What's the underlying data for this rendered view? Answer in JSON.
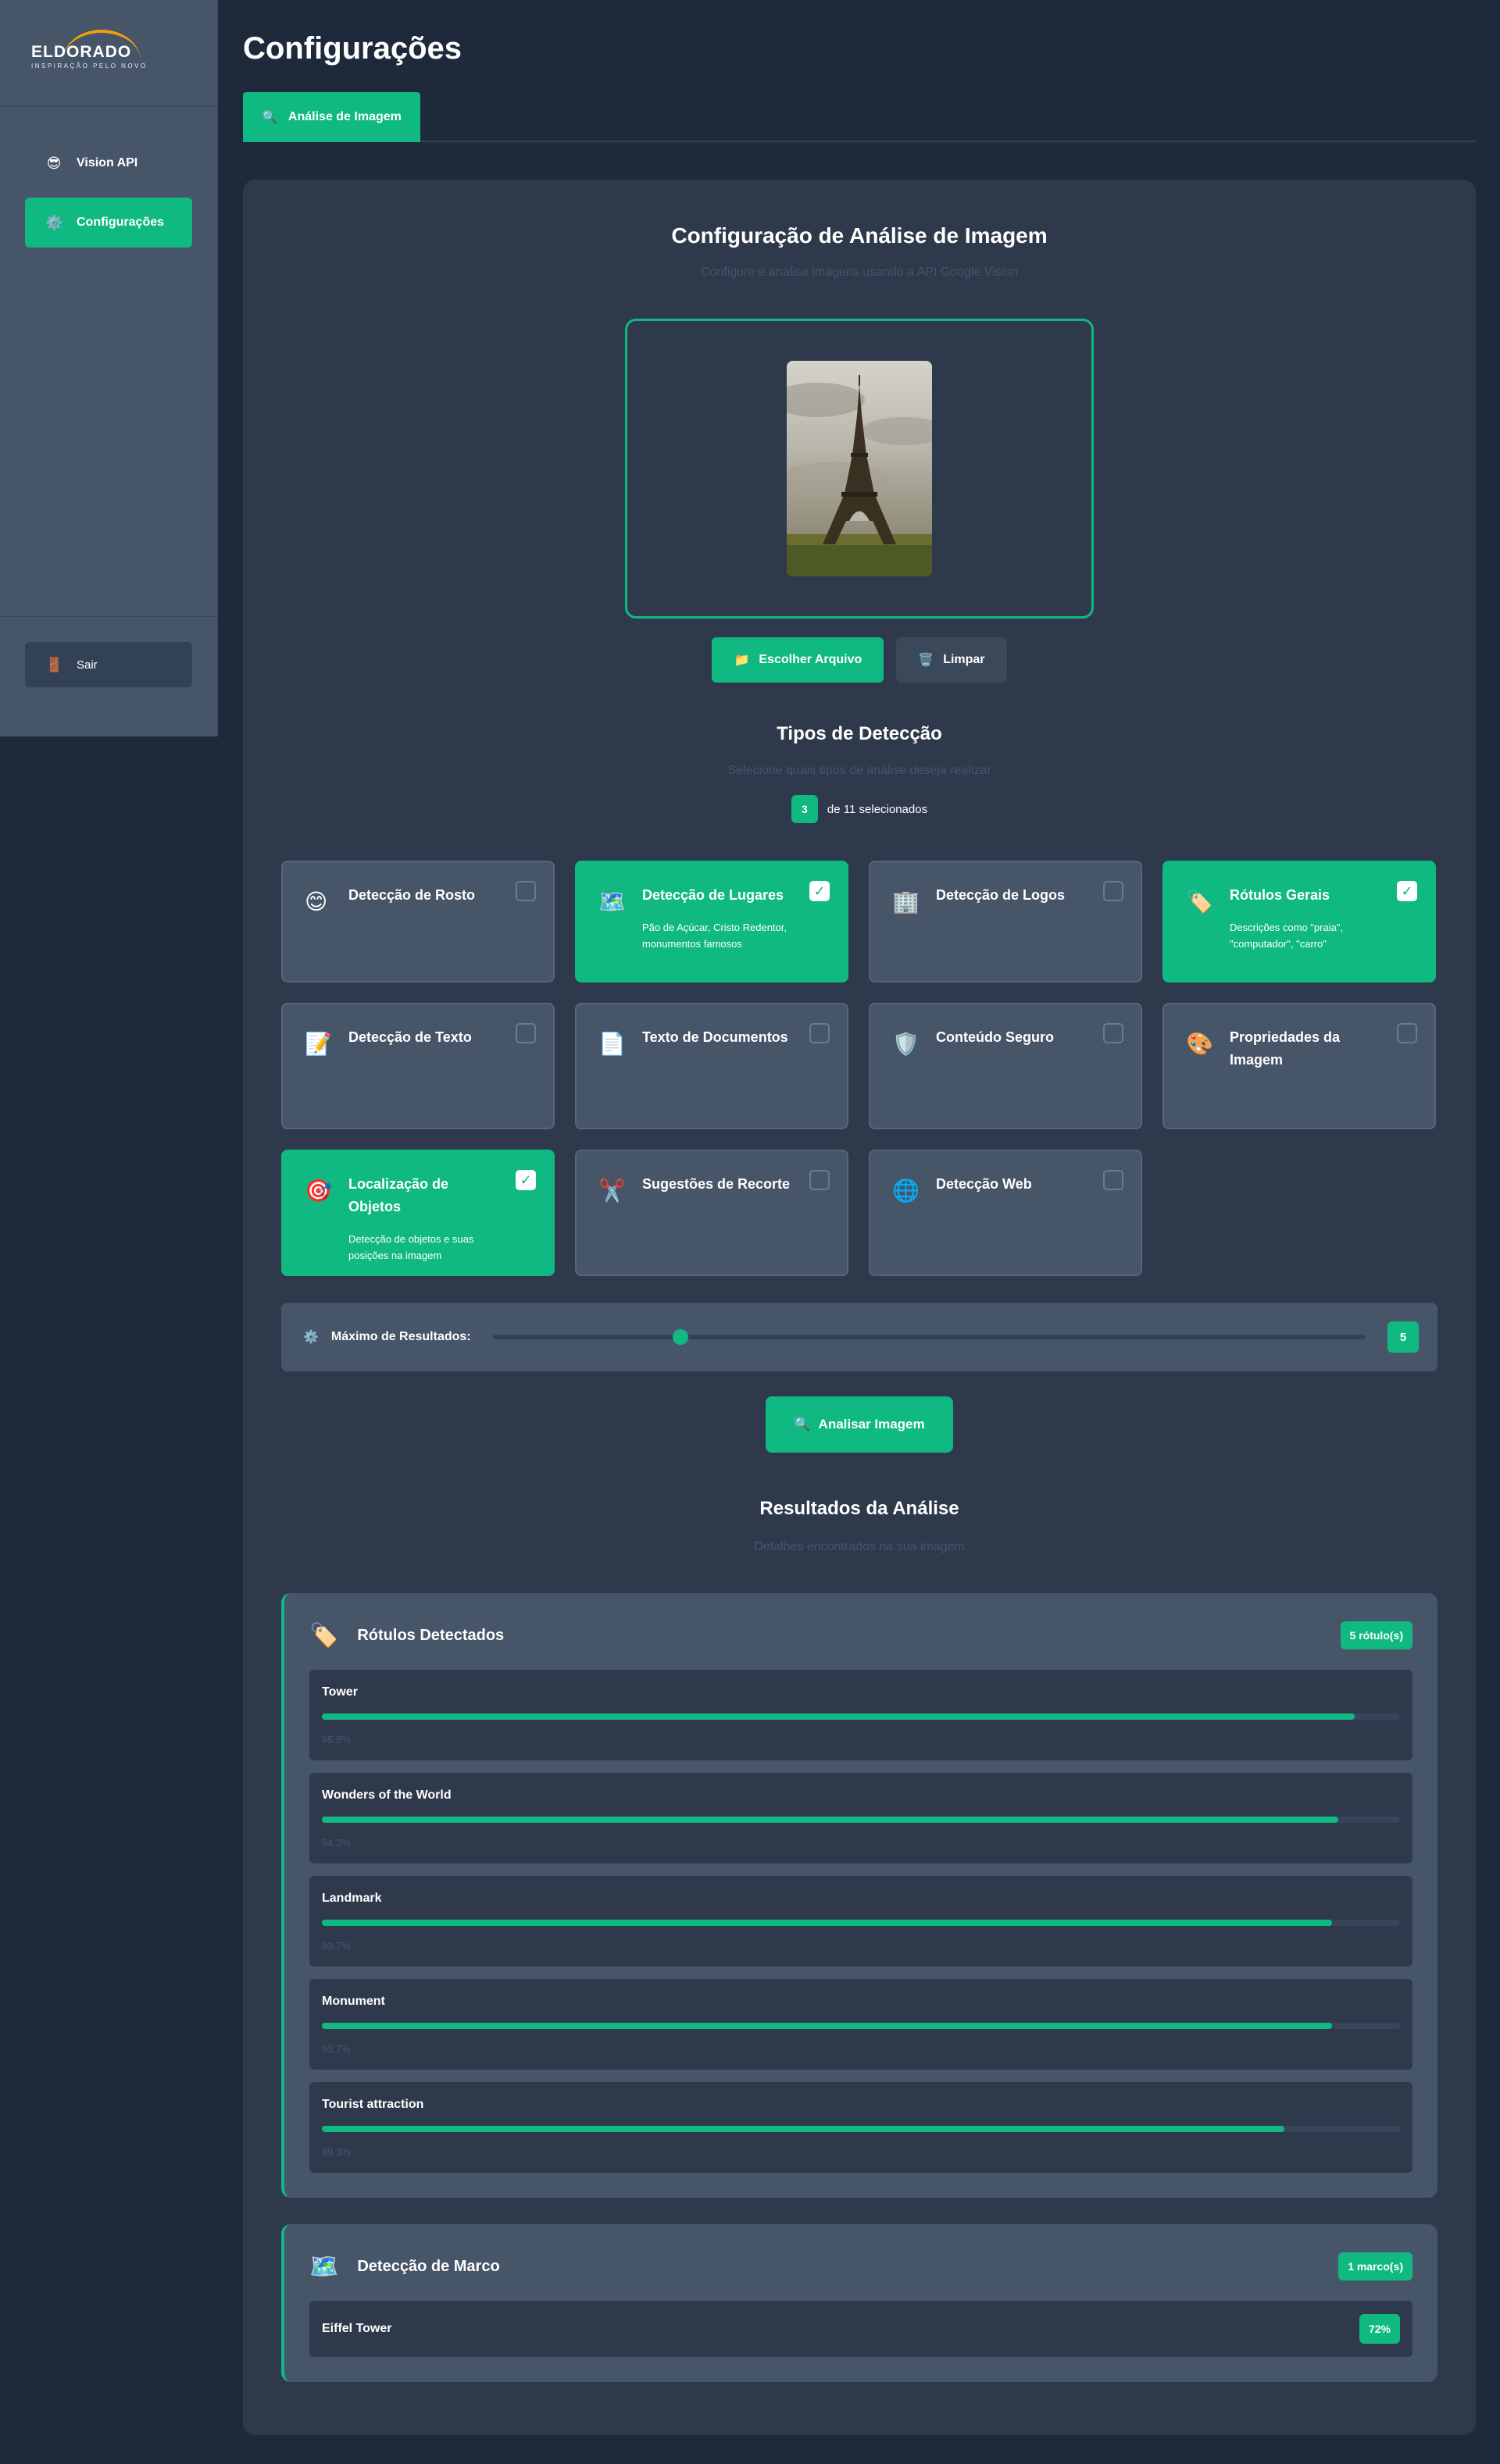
{
  "brand": {
    "name": "ELDORADO",
    "tagline": "INSPIRAÇÃO PELO NOVO"
  },
  "sidebar": {
    "items": [
      {
        "label": "Vision API",
        "icon": "robot-icon",
        "glyph": "😎",
        "active": false
      },
      {
        "label": "Configurações",
        "icon": "gear-icon",
        "glyph": "⚙️",
        "active": true
      }
    ],
    "logout": {
      "label": "Sair",
      "icon": "door-icon",
      "glyph": "🚪"
    }
  },
  "page": {
    "title": "Configurações",
    "tab": {
      "label": "Análise de Imagem",
      "glyph": "🔍"
    }
  },
  "config": {
    "title": "Configuração de Análise de Imagem",
    "subtitle": "Configure e analise imagens usando a API Google Vision",
    "choose_button": "Escolher Arquivo",
    "choose_glyph": "📁",
    "clear_button": "Limpar",
    "clear_glyph": "🗑️"
  },
  "detection": {
    "title": "Tipos de Detecção",
    "subtitle": "Selecione quais tipos de análise deseja realizar",
    "selected_count": "3",
    "selected_suffix": "de 11 selecionados",
    "types": [
      {
        "title": "Detecção de Rosto",
        "desc": "",
        "glyph": "😊",
        "icon": "face-icon",
        "selected": false
      },
      {
        "title": "Detecção de Lugares",
        "desc": "Pão de Açúcar, Cristo Redentor, monumentos famosos",
        "glyph": "🗺️",
        "icon": "map-icon",
        "selected": true
      },
      {
        "title": "Detecção de Logos",
        "desc": "",
        "glyph": "🏢",
        "icon": "building-icon",
        "selected": false
      },
      {
        "title": "Rótulos Gerais",
        "desc": "Descrições como \"praia\", \"computador\", \"carro\"",
        "glyph": "🏷️",
        "icon": "tag-icon",
        "selected": true
      },
      {
        "title": "Detecção de Texto",
        "desc": "",
        "glyph": "📝",
        "icon": "memo-icon",
        "selected": false
      },
      {
        "title": "Texto de Documentos",
        "desc": "",
        "glyph": "📄",
        "icon": "document-icon",
        "selected": false
      },
      {
        "title": "Conteúdo Seguro",
        "desc": "",
        "glyph": "🛡️",
        "icon": "shield-icon",
        "selected": false
      },
      {
        "title": "Propriedades da Imagem",
        "desc": "",
        "glyph": "🎨",
        "icon": "palette-icon",
        "selected": false
      },
      {
        "title": "Localização de Objetos",
        "desc": "Detecção de objetos e suas posições na imagem",
        "glyph": "🎯",
        "icon": "target-icon",
        "selected": true
      },
      {
        "title": "Sugestões de Recorte",
        "desc": "",
        "glyph": "✂️",
        "icon": "scissors-icon",
        "selected": false
      },
      {
        "title": "Detecção Web",
        "desc": "",
        "glyph": "🌐",
        "icon": "globe-icon",
        "selected": false
      }
    ],
    "check_mark": "✓"
  },
  "max_results": {
    "label": "Máximo de Resultados:",
    "glyph": "⚙️",
    "value": "5",
    "fraction": 0.215
  },
  "analyze": {
    "label": "Analisar Imagem",
    "glyph": "🔍"
  },
  "results": {
    "title": "Resultados da Análise",
    "subtitle": "Detalhes encontrados na sua imagem",
    "labels_card": {
      "title": "Rótulos Detectados",
      "glyph": "🏷️",
      "badge": "5 rótulo(s)",
      "items": [
        {
          "name": "Tower",
          "score": "95.8%",
          "fraction": 0.958
        },
        {
          "name": "Wonders of the World",
          "score": "94.3%",
          "fraction": 0.943
        },
        {
          "name": "Landmark",
          "score": "93.7%",
          "fraction": 0.937
        },
        {
          "name": "Monument",
          "score": "93.7%",
          "fraction": 0.937
        },
        {
          "name": "Tourist attraction",
          "score": "89.3%",
          "fraction": 0.893
        }
      ]
    },
    "landmark_card": {
      "title": "Detecção de Marco",
      "glyph": "🗺️",
      "badge": "1 marco(s)",
      "items": [
        {
          "name": "Eiffel Tower",
          "score": "72%"
        }
      ]
    }
  },
  "colors": {
    "accent": "#10b981",
    "background": "#1e293b",
    "card": "#475569",
    "panel": "#2e3a4c"
  }
}
